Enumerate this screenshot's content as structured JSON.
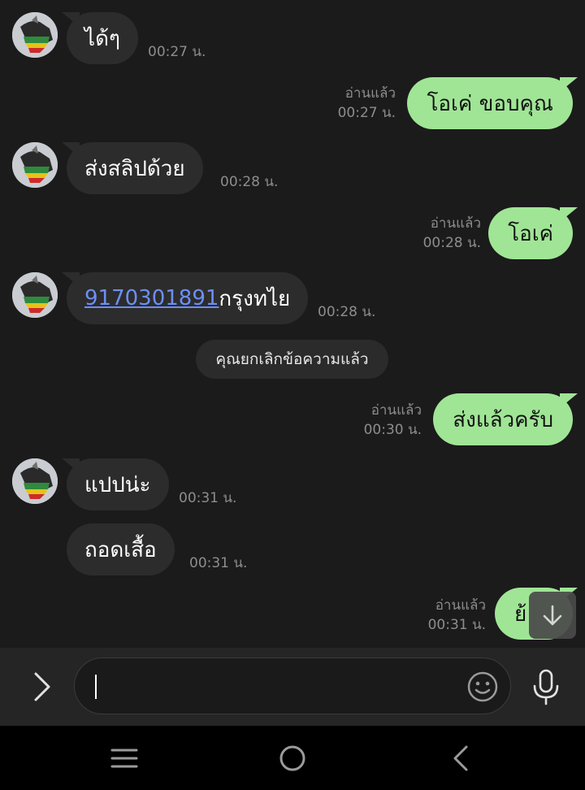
{
  "messages": {
    "m1": {
      "text": "ได้ๆ",
      "time": "00:27 น."
    },
    "m2": {
      "text": "โอเค่ ขอบคุณ",
      "read": "อ่านแล้ว",
      "time": "00:27 น."
    },
    "m3": {
      "text": "ส่งสลิปด้วย",
      "time": "00:28 น."
    },
    "m4": {
      "text": "โอเค่",
      "read": "อ่านแล้ว",
      "time": "00:28 น."
    },
    "m5": {
      "link": "9170301891",
      "text": "กรุงทไย",
      "time": "00:28 น."
    },
    "m6": {
      "text": "ส่งแล้วครับ",
      "read": "อ่านแล้ว",
      "time": "00:30 น."
    },
    "m7": {
      "text": "แปปน่ะ",
      "time": "00:31 น."
    },
    "m8": {
      "text": "ถอดเสื้อ",
      "time": "00:31 น."
    },
    "m9": {
      "text": "ย้",
      "read": "อ่านแล้ว",
      "time": "00:31 น."
    }
  },
  "system_notice": "คุณยกเลิกข้อความแล้ว",
  "composer": {
    "value": "",
    "placeholder": ""
  },
  "icons": {
    "expand": "chevron-right-icon",
    "emoji": "smiley-icon",
    "mic": "microphone-icon",
    "scroll": "arrow-down-icon",
    "nav_recents": "menu-lines-icon",
    "nav_home": "home-circle-icon",
    "nav_back": "back-chevron-icon"
  },
  "colors": {
    "background": "#1b1b1b",
    "incoming_bubble": "#2c2c2c",
    "outgoing_bubble": "#a0e596",
    "link": "#6c8ff5",
    "meta_text": "#8d8d8d"
  }
}
